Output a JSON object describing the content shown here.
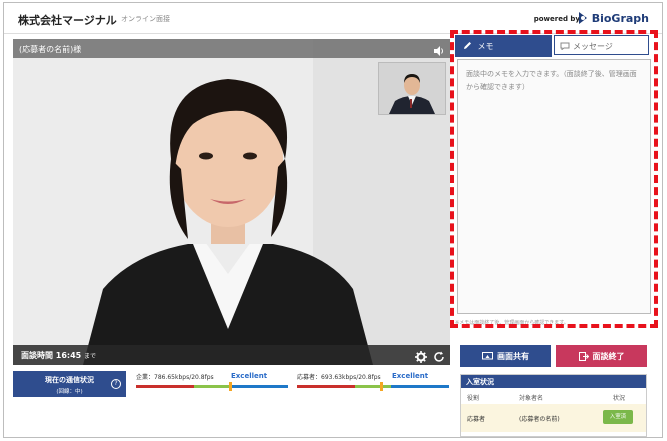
{
  "header": {
    "company": "株式会社マージナル",
    "subtitle": "オンライン面接",
    "powered_by": "powered by",
    "logo_text": "BioGraph"
  },
  "video": {
    "applicant_label": "(応募者の名前)様",
    "timer_label": "面談時間 16:45",
    "timer_suffix": "まで"
  },
  "status_button": {
    "line1": "現在の通信状況",
    "line2": "(回線：中)",
    "help": "?"
  },
  "metrics": [
    {
      "label": "企業：786.65kbps/20.8fps",
      "quality": "Excellent",
      "level": 0.62
    },
    {
      "label": "応募者：693.63kbps/20.8fps",
      "quality": "Excellent",
      "level": 0.55
    }
  ],
  "memo_panel": {
    "tab_memo": "メモ",
    "tab_message": "メッセージ",
    "placeholder": "面談中のメモを入力できます。（面談終了後、管理画面から確認できます）",
    "note": "※メモは面談終了後、管理画面から確認できます。"
  },
  "buttons": {
    "share": "画面共有",
    "end": "面談終了"
  },
  "entry_status": {
    "title": "入室状況",
    "columns": [
      "役割",
      "対象者名",
      "状況"
    ],
    "rows": [
      {
        "role": "応募者",
        "name": "(応募者の名前)",
        "status": "入室済"
      }
    ]
  },
  "colors": {
    "navy": "#2f4d8e",
    "end_red": "#c8385d",
    "highlight_red": "#e8121c",
    "excellent_blue": "#2b6cc8",
    "badge_green": "#7bb84a"
  }
}
